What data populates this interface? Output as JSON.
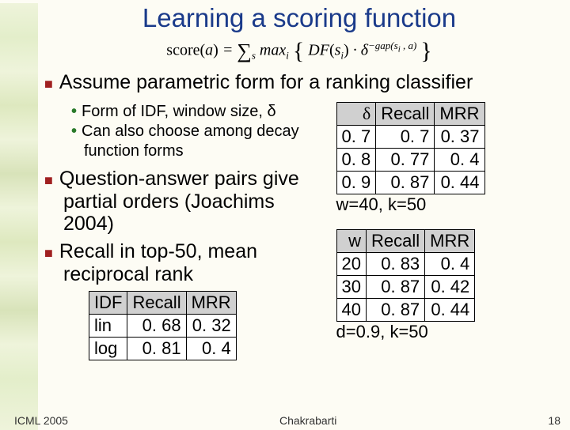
{
  "title": "Learning a scoring function",
  "formula_html": "<span class='rm'>score(</span>a<span class='rm'>)</span> = <span class='sigma'>&#8721;</span><span class='sub'>s</span> max<span class='sub'>i</span> <span class='brace'>{</span> DF<span class='rm'>(</span>s<span class='sub'>i</span><span class='rm'>)</span> &middot; &delta;<span class='sup'>&minus;gap(s<sub>i</sub> , a)</span> <span class='brace'>}</span>",
  "bullets": {
    "b1": "Assume parametric form for a ranking classifier",
    "b1a": "Form of IDF, window size, δ",
    "b1b": "Can also choose among decay function forms",
    "b2": "Question-answer pairs give partial orders (Joachims 2004)",
    "b3": "Recall in top-50, mean reciprocal rank"
  },
  "chart_data": [
    {
      "type": "table",
      "name": "idf",
      "columns": [
        "IDF",
        "Recall",
        "MRR"
      ],
      "rows": [
        {
          "label": "lin",
          "recall": "0. 68",
          "mrr": "0. 32"
        },
        {
          "label": "log",
          "recall": "0. 81",
          "mrr": "0. 4"
        }
      ]
    },
    {
      "type": "table",
      "name": "delta",
      "columns": [
        "δ",
        "Recall",
        "MRR"
      ],
      "rows": [
        {
          "d": "0. 7",
          "recall": "0. 7",
          "mrr": "0. 37"
        },
        {
          "d": "0. 8",
          "recall": "0. 77",
          "mrr": "0. 4"
        },
        {
          "d": "0. 9",
          "recall": "0. 87",
          "mrr": "0. 44"
        }
      ],
      "caption": "w=40, k=50"
    },
    {
      "type": "table",
      "name": "w",
      "columns": [
        "w",
        "Recall",
        "MRR"
      ],
      "rows": [
        {
          "w": "20",
          "recall": "0. 83",
          "mrr": "0. 4"
        },
        {
          "w": "30",
          "recall": "0. 87",
          "mrr": "0. 42"
        },
        {
          "w": "40",
          "recall": "0. 87",
          "mrr": "0. 44"
        }
      ],
      "caption": "d=0.9, k=50"
    }
  ],
  "footer": {
    "left": "ICML 2005",
    "center": "Chakrabarti",
    "right": "18"
  }
}
